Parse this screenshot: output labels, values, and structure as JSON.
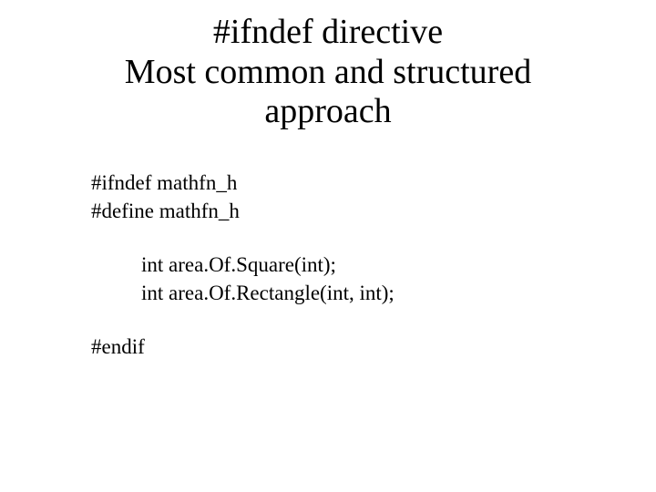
{
  "title_line1": "#ifndef directive",
  "title_line2": "Most common and structured",
  "title_line3": "approach",
  "code": {
    "l1": "#ifndef mathfn_h",
    "l2": "#define mathfn_h",
    "l3": "int area.Of.Square(int);",
    "l4": "int area.Of.Rectangle(int, int);",
    "l5": "#endif"
  }
}
